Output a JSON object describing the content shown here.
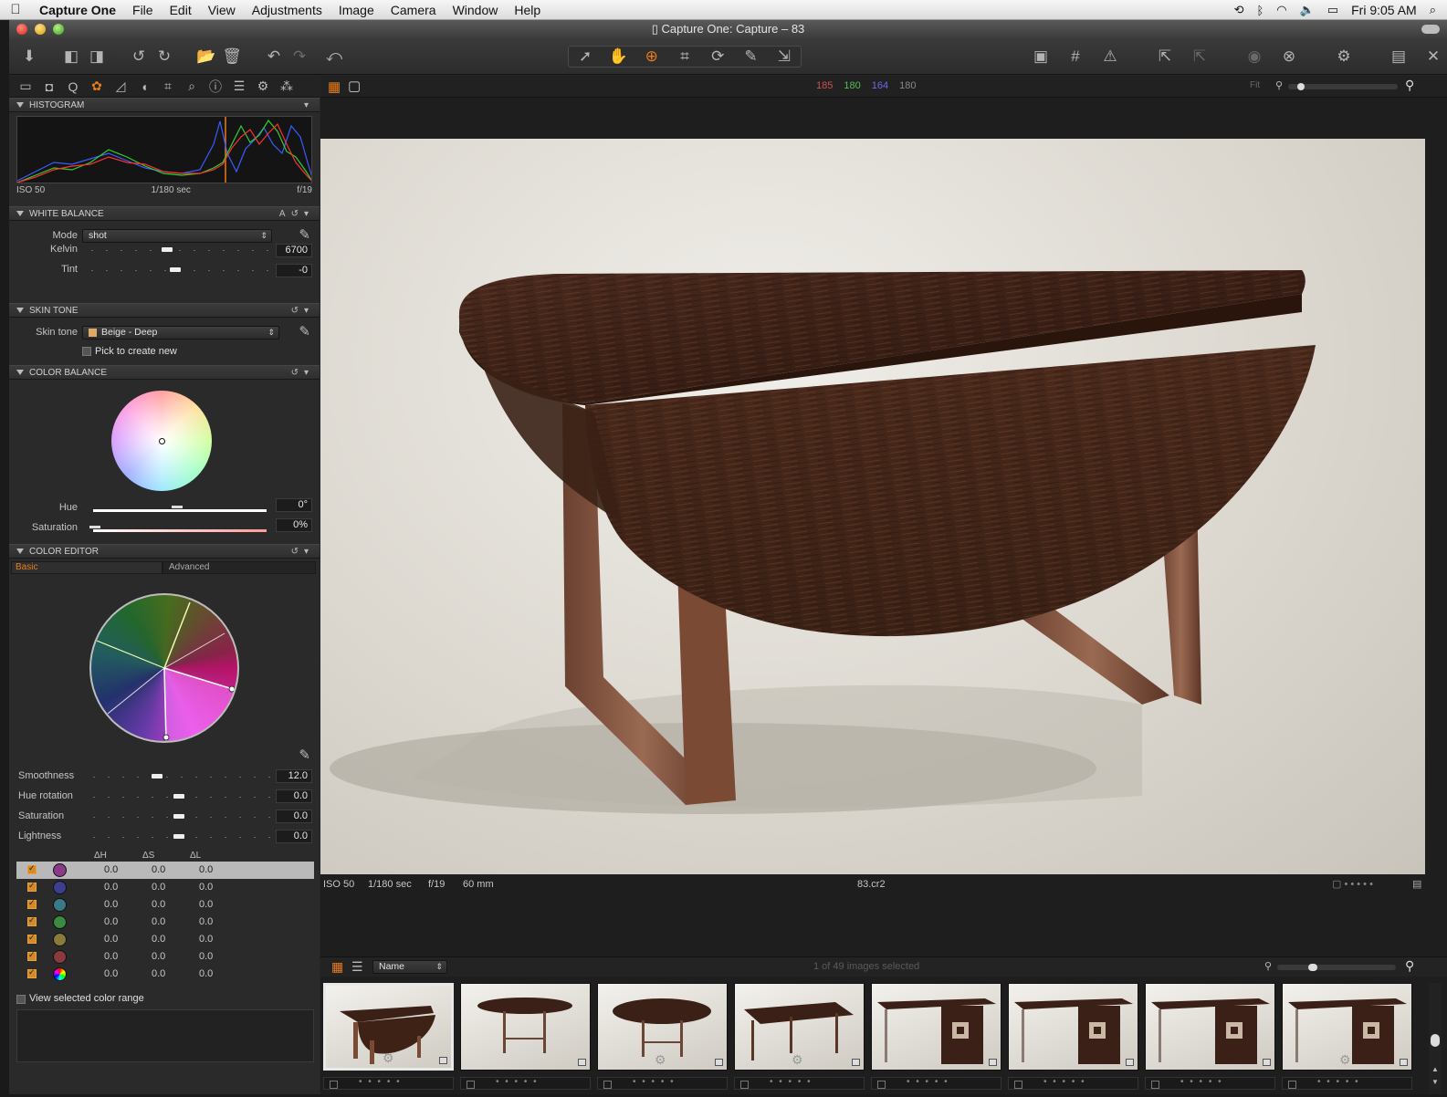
{
  "menubar": {
    "app": "Capture One",
    "items": [
      "File",
      "Edit",
      "View",
      "Adjustments",
      "Image",
      "Camera",
      "Window",
      "Help"
    ],
    "clock": "Fri 9:05 AM"
  },
  "window": {
    "title": "Capture One: Capture – 83"
  },
  "histogram": {
    "iso": "ISO 50",
    "shutter": "1/180 sec",
    "aperture": "f/19"
  },
  "sections": {
    "histogram": "HISTOGRAM",
    "white_balance": "WHITE BALANCE",
    "skin_tone": "SKIN TONE",
    "color_balance": "COLOR BALANCE",
    "color_editor": "COLOR EDITOR"
  },
  "white_balance": {
    "auto_label": "A",
    "mode_label": "Mode",
    "mode_value": "shot",
    "kelvin_label": "Kelvin",
    "kelvin_value": "6700",
    "kelvin_level": 0.42,
    "tint_label": "Tint",
    "tint_value": "-0",
    "tint_level": 0.47
  },
  "skin_tone": {
    "label": "Skin tone",
    "value": "Beige - Deep",
    "swatch": "#e0a968",
    "pick_label": "Pick to create new"
  },
  "color_balance": {
    "hue_label": "Hue",
    "hue_value": "0°",
    "saturation_label": "Saturation",
    "saturation_value": "0%"
  },
  "color_editor": {
    "tabs": [
      "Basic",
      "Advanced"
    ],
    "smoothness_label": "Smoothness",
    "smoothness_value": "12.0",
    "hue_rotation_label": "Hue rotation",
    "hue_rotation_value": "0.0",
    "saturation_label": "Saturation",
    "saturation_value": "0.0",
    "lightness_label": "Lightness",
    "lightness_value": "0.0",
    "table_headers": [
      "ΔH",
      "ΔS",
      "ΔL"
    ],
    "rows": [
      {
        "color": "#8a3a86",
        "dh": "0.0",
        "ds": "0.0",
        "dl": "0.0"
      },
      {
        "color": "#3b3f8e",
        "dh": "0.0",
        "ds": "0.0",
        "dl": "0.0"
      },
      {
        "color": "#3a7a86",
        "dh": "0.0",
        "ds": "0.0",
        "dl": "0.0"
      },
      {
        "color": "#3b8a3f",
        "dh": "0.0",
        "ds": "0.0",
        "dl": "0.0"
      },
      {
        "color": "#8a7a3c",
        "dh": "0.0",
        "ds": "0.0",
        "dl": "0.0"
      },
      {
        "color": "#8a3a3a",
        "dh": "0.0",
        "ds": "0.0",
        "dl": "0.0"
      },
      {
        "color": "rainbow",
        "dh": "0.0",
        "ds": "0.0",
        "dl": "0.0"
      }
    ],
    "view_range_label": "View selected color range"
  },
  "viewer": {
    "rgb": {
      "r": "185",
      "g": "180",
      "b": "164",
      "l": "180"
    },
    "fit_label": "Fit",
    "info": {
      "iso": "ISO 50",
      "shutter": "1/180 sec",
      "aperture": "f/19",
      "focal": "60 mm",
      "filename": "83.cr2"
    }
  },
  "browser": {
    "sort_value": "Name",
    "count_text": "1 of 49 images selected"
  },
  "colors": {
    "accent": "#e87c1a",
    "panel": "#2a2a2a",
    "background": "#1e1e1e"
  }
}
